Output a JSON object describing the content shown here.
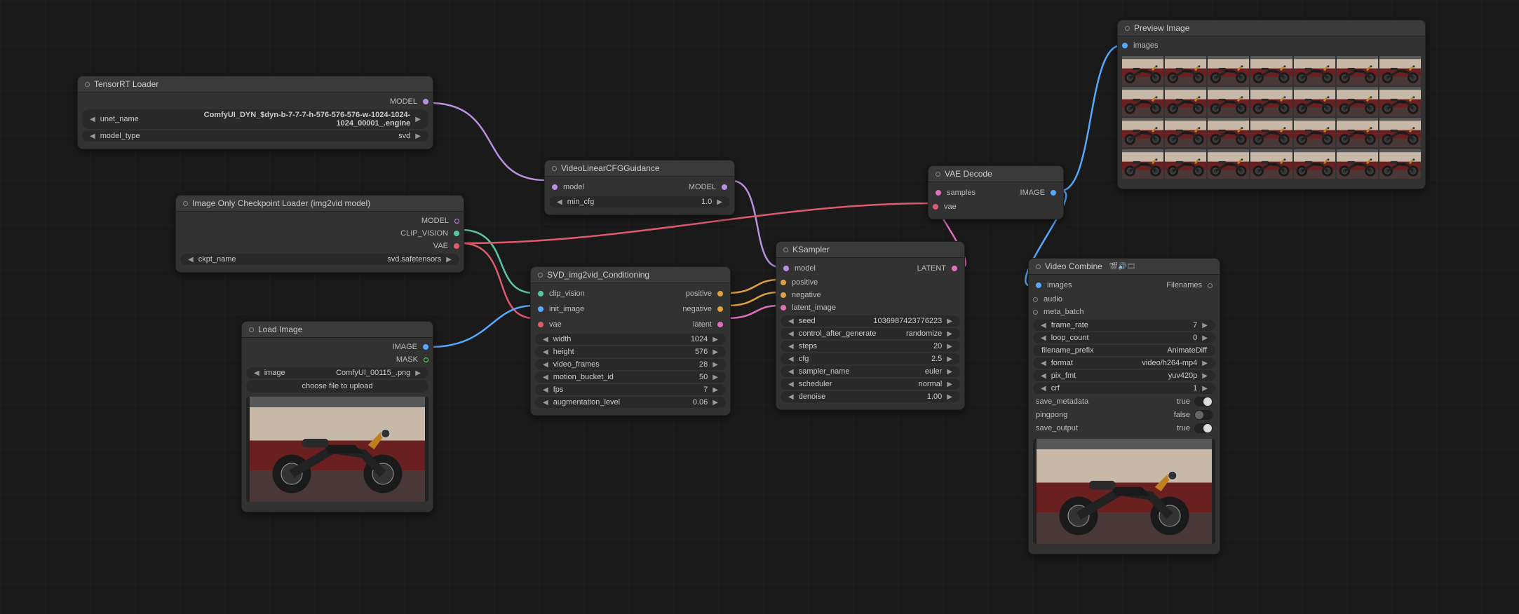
{
  "nodes": {
    "tensorrt": {
      "title": "TensorRT Loader",
      "outputs": {
        "model": "MODEL"
      },
      "widgets": {
        "unet_name": {
          "label": "unet_name",
          "value": "ComfyUI_DYN_$dyn-b-7-7-7-h-576-576-576-w-1024-1024-1024_00001_.engine"
        },
        "model_type": {
          "label": "model_type",
          "value": "svd"
        }
      }
    },
    "ckpt": {
      "title": "Image Only Checkpoint Loader (img2vid model)",
      "outputs": {
        "model": "MODEL",
        "clip_vision": "CLIP_VISION",
        "vae": "VAE"
      },
      "widgets": {
        "ckpt_name": {
          "label": "ckpt_name",
          "value": "svd.safetensors"
        }
      }
    },
    "loadimage": {
      "title": "Load Image",
      "outputs": {
        "image": "IMAGE",
        "mask": "MASK"
      },
      "widgets": {
        "image": {
          "label": "image",
          "value": "ComfyUI_00115_.png"
        },
        "upload": "choose file to upload"
      }
    },
    "cfg": {
      "title": "VideoLinearCFGGuidance",
      "inputs": {
        "model": "model"
      },
      "outputs": {
        "model": "MODEL"
      },
      "widgets": {
        "min_cfg": {
          "label": "min_cfg",
          "value": "1.0"
        }
      }
    },
    "svd": {
      "title": "SVD_img2vid_Conditioning",
      "inputs": {
        "clip_vision": "clip_vision",
        "init_image": "init_image",
        "vae": "vae"
      },
      "outputs": {
        "positive": "positive",
        "negative": "negative",
        "latent": "latent"
      },
      "widgets": {
        "width": {
          "label": "width",
          "value": "1024"
        },
        "height": {
          "label": "height",
          "value": "576"
        },
        "video_frames": {
          "label": "video_frames",
          "value": "28"
        },
        "motion_bucket_id": {
          "label": "motion_bucket_id",
          "value": "50"
        },
        "fps": {
          "label": "fps",
          "value": "7"
        },
        "augmentation_level": {
          "label": "augmentation_level",
          "value": "0.06"
        }
      }
    },
    "ksampler": {
      "title": "KSampler",
      "inputs": {
        "model": "model",
        "positive": "positive",
        "negative": "negative",
        "latent_image": "latent_image"
      },
      "outputs": {
        "latent": "LATENT"
      },
      "widgets": {
        "seed": {
          "label": "seed",
          "value": "1036987423776223"
        },
        "control_after_generate": {
          "label": "control_after_generate",
          "value": "randomize"
        },
        "steps": {
          "label": "steps",
          "value": "20"
        },
        "cfg": {
          "label": "cfg",
          "value": "2.5"
        },
        "sampler_name": {
          "label": "sampler_name",
          "value": "euler"
        },
        "scheduler": {
          "label": "scheduler",
          "value": "normal"
        },
        "denoise": {
          "label": "denoise",
          "value": "1.00"
        }
      }
    },
    "vaedecode": {
      "title": "VAE Decode",
      "inputs": {
        "samples": "samples",
        "vae": "vae"
      },
      "outputs": {
        "image": "IMAGE"
      }
    },
    "preview": {
      "title": "Preview Image",
      "inputs": {
        "images": "images"
      }
    },
    "combine": {
      "title": "Video Combine",
      "badges": "🎬🔊🎞",
      "inputs": {
        "images": "images",
        "audio": "audio",
        "meta_batch": "meta_batch"
      },
      "outputs": {
        "filenames": "Filenames"
      },
      "widgets": {
        "frame_rate": {
          "label": "frame_rate",
          "value": "7"
        },
        "loop_count": {
          "label": "loop_count",
          "value": "0"
        },
        "filename_prefix": {
          "label": "filename_prefix",
          "value": "AnimateDiff"
        },
        "format": {
          "label": "format",
          "value": "video/h264-mp4"
        },
        "pix_fmt": {
          "label": "pix_fmt",
          "value": "yuv420p"
        },
        "crf": {
          "label": "crf",
          "value": "1"
        }
      },
      "toggles": {
        "save_metadata": {
          "label": "save_metadata",
          "value": "true",
          "on": true
        },
        "pingpong": {
          "label": "pingpong",
          "value": "false",
          "on": false
        },
        "save_output": {
          "label": "save_output",
          "value": "true",
          "on": true
        }
      }
    }
  },
  "colors": {
    "model": "#b98fe0",
    "clip_vision": "#5bc6a6",
    "vae": "#e05a6e",
    "image": "#57a8ff",
    "mask": "#6fdc6f",
    "latent": "#e070c0",
    "positive": "#e0a040",
    "negative": "#e0a040",
    "filenames": "#bbbbbb",
    "audio": "#888888",
    "meta": "#888888"
  }
}
